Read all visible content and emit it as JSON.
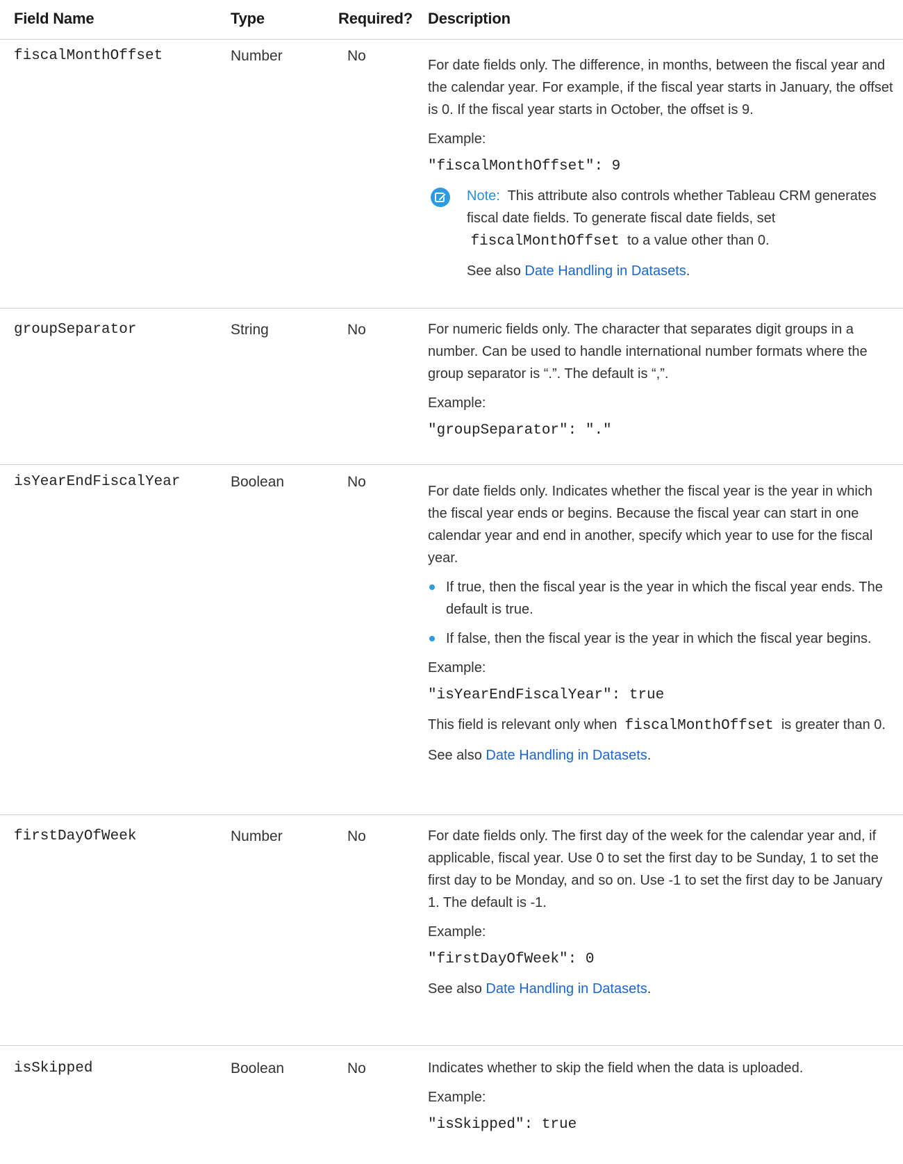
{
  "header": {
    "field_name": "Field Name",
    "type": "Type",
    "required": "Required?",
    "description": "Description"
  },
  "rows": [
    {
      "name": "fiscalMonthOffset",
      "type": "Number",
      "required": "No",
      "desc1": "For date fields only. The difference, in months, between the fiscal year and the calendar year. For example, if the fiscal year starts in January, the offset is 0. If the fiscal year starts in October, the offset is 9.",
      "example_label": "Example:",
      "example_code": "\"fiscalMonthOffset\": 9",
      "note_label": "Note:",
      "note_text_a": "This attribute also controls whether Tableau CRM generates fiscal date fields. To generate fiscal date fields, set",
      "note_code": "fiscalMonthOffset",
      "note_text_b": "to a value other than 0.",
      "see_also": "See also",
      "link": "Date Handling in Datasets"
    },
    {
      "name": "groupSeparator",
      "type": "String",
      "required": "No",
      "desc1": "For numeric fields only. The character that separates digit groups in a number. Can be used to handle international number formats where the group separator is “.”. The default is “,”.",
      "example_label": "Example:",
      "example_code": "\"groupSeparator\": \".\""
    },
    {
      "name": "isYearEndFiscalYear",
      "type": "Boolean",
      "required": "No",
      "desc1": "For date fields only. Indicates whether the fiscal year is the year in which the fiscal year ends or begins. Because the fiscal year can start in one calendar year and end in another, specify which year to use for the fiscal year.",
      "bullet1": "If true, then the fiscal year is the year in which the fiscal year ends. The default is true.",
      "bullet2": "If false, then the fiscal year is the year in which the fiscal year begins.",
      "example_label": "Example:",
      "example_code": "\"isYearEndFiscalYear\": true",
      "rel_a": "This field is relevant only when",
      "rel_code": "fiscalMonthOffset",
      "rel_b": "is greater than 0.",
      "see_also": "See also",
      "link": "Date Handling in Datasets"
    },
    {
      "name": "firstDayOfWeek",
      "type": "Number",
      "required": "No",
      "desc1": "For date fields only. The first day of the week for the calendar year and, if applicable, fiscal year. Use 0 to set the first day to be Sunday, 1 to set the first day to be Monday, and so on. Use -1 to set the first day to be January 1. The default is -1.",
      "example_label": "Example:",
      "example_code": "\"firstDayOfWeek\": 0",
      "see_also": "See also",
      "link": "Date Handling in Datasets"
    },
    {
      "name": "isSkipped",
      "type": "Boolean",
      "required": "No",
      "desc1": "Indicates whether to skip the field when the data is uploaded.",
      "example_label": "Example:",
      "example_code": "\"isSkipped\": true"
    }
  ]
}
